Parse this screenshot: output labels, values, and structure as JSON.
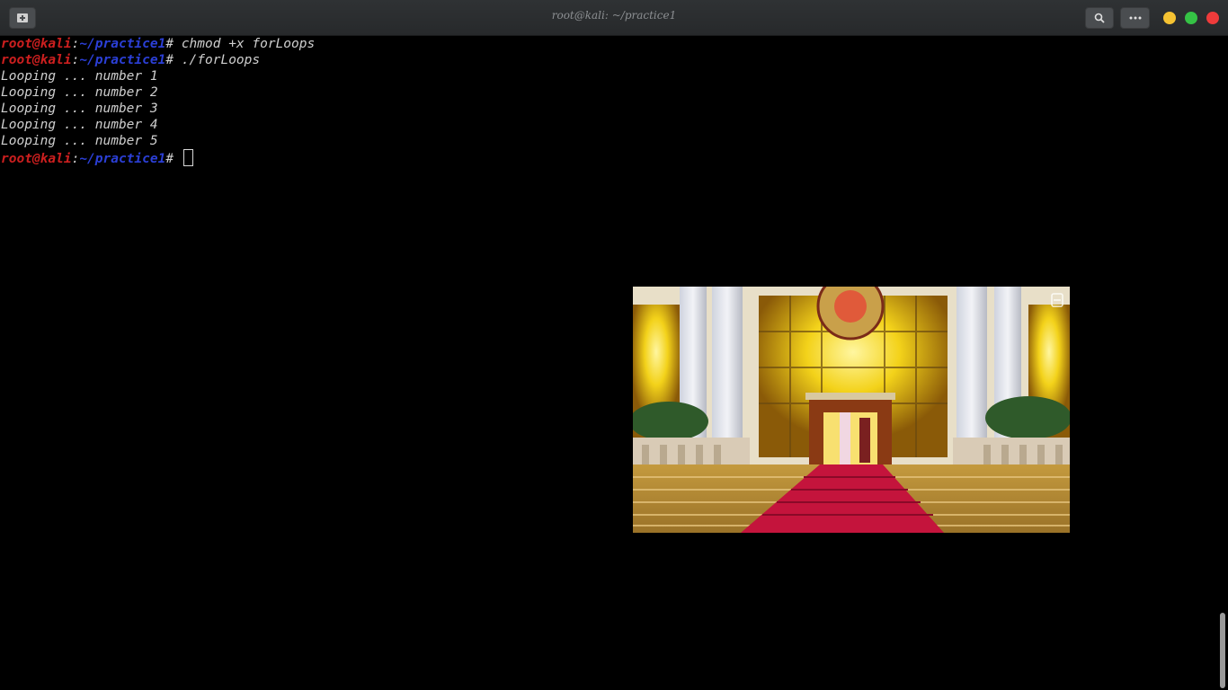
{
  "window": {
    "title": "root@kali: ~/practice1"
  },
  "titlebar": {
    "new_tab_icon": "terminal-add-icon",
    "search_icon": "search-icon",
    "menu_icon": "ellipsis-icon",
    "controls": {
      "minimize_color": "#f5c232",
      "maximize_color": "#35c245",
      "close_color": "#ee3b3b"
    }
  },
  "terminal": {
    "prompt": {
      "user": "root@kali",
      "colon": ":",
      "path": "~/practice1",
      "symbol": "# "
    },
    "commands": [
      "chmod +x forLoops",
      "./forLoops"
    ],
    "output": [
      "Looping ... number 1",
      "Looping ... number 2",
      "Looping ... number 3",
      "Looping ... number 4",
      "Looping ... number 5"
    ]
  },
  "video_overlay": {
    "watermark_icon": "channel-logo-icon"
  }
}
